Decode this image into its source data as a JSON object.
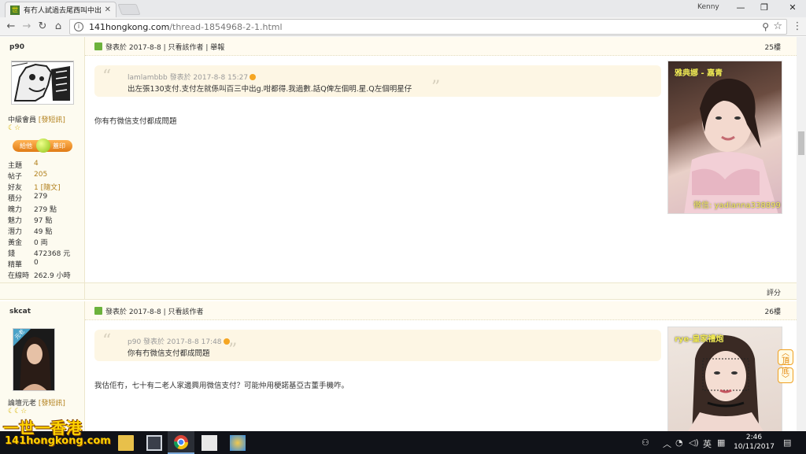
{
  "browser": {
    "tab_title": "有冇人試過去尾西叫中出",
    "tab_close": "✕",
    "favicon_text": "世",
    "user": "Kenny",
    "url_host": "141hongkong.com",
    "url_path": "/thread-1854968-2-1.html",
    "window_minimize": "—",
    "window_restore": "❐",
    "window_close": "✕"
  },
  "posts": [
    {
      "username": "p90",
      "rank": "中級會員",
      "rank_link": "[發短訊]",
      "stars": "☾☆",
      "ad_left": "給他",
      "ad_right": "蓋印",
      "stats": [
        {
          "k": "主題",
          "v": "4",
          "link": true
        },
        {
          "k": "帖子",
          "v": "205",
          "link": true
        },
        {
          "k": "好友",
          "v": "1 [隨文]",
          "link": true
        },
        {
          "k": "積分",
          "v": "279",
          "link": false
        },
        {
          "k": "魄力",
          "v": "279 點",
          "link": false
        },
        {
          "k": "魅力",
          "v": "97 點",
          "link": false
        },
        {
          "k": "潛力",
          "v": "49 點",
          "link": false
        },
        {
          "k": "黃金",
          "v": "0 両",
          "link": false
        },
        {
          "k": "錢",
          "v": "472368 元",
          "link": false
        },
        {
          "k": "精華",
          "v": "0",
          "link": false
        },
        {
          "k": "在線時",
          "v": "262.9 小時",
          "link": false
        }
      ],
      "header": "發表於 2017-8-8 | 只看該作者 | 舉報",
      "floor": "25樓",
      "quote_meta": "lamlambbb 發表於 2017-8-8 15:27",
      "quote_text": "出左張130支付.支付左就係叫百三中出g.咁都得.我過數.話Q俾左個明.星.Q左個明星仔",
      "body": "你有冇微信支付都成問題",
      "ad_caption_top": "雅典娜 - 嘉青",
      "ad_caption_bot": "微信: yadianna338899",
      "rate": "評分"
    },
    {
      "username": "skcat",
      "rank": "論壇元老",
      "rank_link": "[發短訊]",
      "stars": "☾☾☆",
      "badge": "元老",
      "header": "發表於 2017-8-8 | 只看該作者",
      "floor": "26樓",
      "quote_meta": "p90 發表於 2017-8-8 17:48",
      "quote_text": "你有冇微信支付都成問題",
      "body": "我估佢冇，七十有二老人家邊興用微信支付？可能仲用梗諾基亞古董手機咋。",
      "ad_caption_top": "rye-皇家禮炮"
    }
  ],
  "float_buttons": {
    "top": "頂",
    "bottom": "底"
  },
  "taskbar": {
    "tray_ime": "英",
    "time": "2:46",
    "date": "10/11/2017"
  },
  "watermark": {
    "line1": "一世一香港",
    "line2": "141hongkong.com"
  },
  "colors": {
    "accent": "#b2801c",
    "sidebar_bg": "#fdfbf0",
    "quote_bg": "#fdf6e4"
  }
}
